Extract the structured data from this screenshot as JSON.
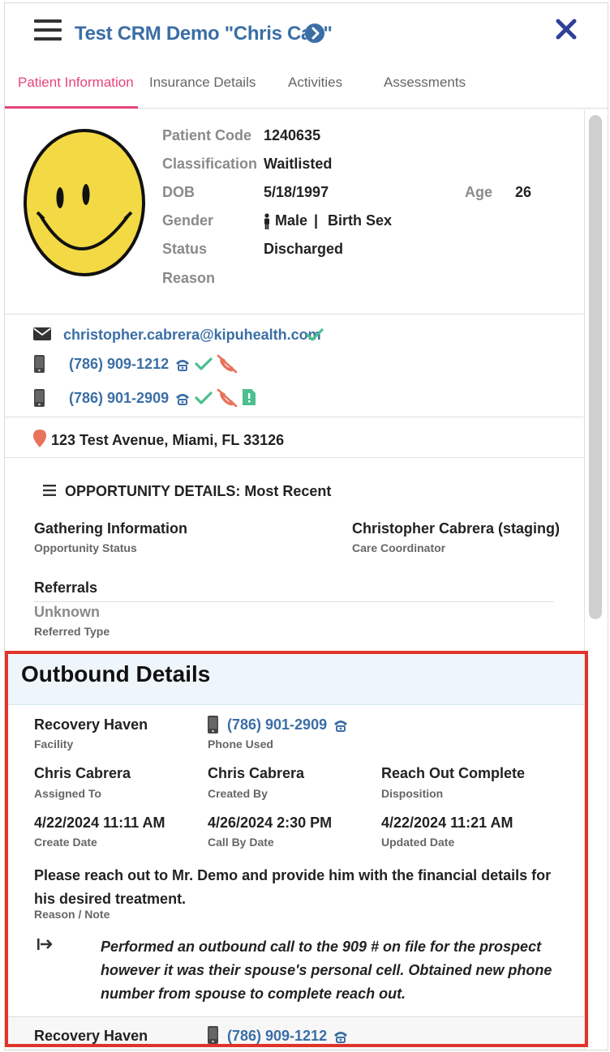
{
  "header": {
    "title": "Test CRM Demo \"Chris Cab\""
  },
  "tabs": [
    {
      "label": "Patient Information"
    },
    {
      "label": "Insurance Details"
    },
    {
      "label": "Activities"
    },
    {
      "label": "Assessments"
    }
  ],
  "patient": {
    "code_label": "Patient Code",
    "code": "1240635",
    "classification_label": "Classification",
    "classification": "Waitlisted",
    "dob_label": "DOB",
    "dob": "5/18/1997",
    "age_label": "Age",
    "age": "26",
    "gender_label": "Gender",
    "gender": "Male",
    "gender_sep": "|",
    "birth_sex": "Birth Sex",
    "status_label": "Status",
    "status": "Discharged",
    "reason_label": "Reason"
  },
  "contact": {
    "email": "christopher.cabrera@kipuhealth.com",
    "phone1": "(786) 909-1212",
    "phone2": "(786) 901-2909",
    "address": "123 Test Avenue, Miami, FL 33126"
  },
  "opportunity": {
    "title": "OPPORTUNITY DETAILS: Most Recent",
    "status_value": "Gathering Information",
    "status_label": "Opportunity Status",
    "coordinator_value": "Christopher Cabrera (staging)",
    "coordinator_label": "Care Coordinator",
    "referrals_heading": "Referrals",
    "referred_type_value": "Unknown",
    "referred_type_label": "Referred Type"
  },
  "outbound": {
    "title": "Outbound Details",
    "facility_value": "Recovery Haven",
    "facility_label": "Facility",
    "phone_used_value": "(786) 901-2909",
    "phone_used_label": "Phone Used",
    "assigned_value": "Chris Cabrera",
    "assigned_label": "Assigned To",
    "created_by_value": "Chris Cabrera",
    "created_by_label": "Created By",
    "disposition_value": "Reach Out Complete",
    "disposition_label": "Disposition",
    "create_date_value": "4/22/2024 11:11 AM",
    "create_date_label": "Create Date",
    "call_by_value": "4/26/2024 2:30 PM",
    "call_by_label": "Call By Date",
    "updated_value": "4/22/2024 11:21 AM",
    "updated_label": "Updated Date",
    "note": "Please reach out to Mr. Demo and provide him with the financial details for his desired treatment.",
    "note_label": "Reason / Note",
    "reply": "Performed an outbound call to the 909 # on file for the prospect however it was their spouse's personal cell. Obtained new phone number from spouse to complete reach out.",
    "next_facility_value": "Recovery Haven",
    "next_phone_value": "(786) 909-1212"
  },
  "colors": {
    "accent": "#3b6ea5",
    "tab_active": "#e6457a",
    "check": "#4cbf8f",
    "no_call": "#e8735a",
    "highlight": "#e0342a"
  },
  "icons": [
    "hamburger-icon",
    "arrow-circle-icon",
    "close-icon",
    "envelope-icon",
    "mobile-phone-icon",
    "telephone-icon",
    "check-icon",
    "no-call-icon",
    "document-icon",
    "map-pin-icon",
    "list-icon",
    "reply-arrow-icon",
    "male-icon"
  ]
}
